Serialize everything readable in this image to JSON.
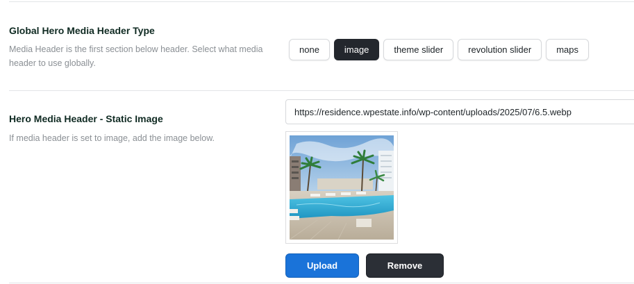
{
  "media_type": {
    "title": "Global Hero Media Header Type",
    "description": "Media Header is the first section below header. Select what media header to use globally.",
    "options": [
      {
        "label": "none",
        "active": false
      },
      {
        "label": "image",
        "active": true
      },
      {
        "label": "theme slider",
        "active": false
      },
      {
        "label": "revolution slider",
        "active": false
      },
      {
        "label": "maps",
        "active": false
      }
    ]
  },
  "static_image": {
    "title": "Hero Media Header - Static Image",
    "description": "If media header is set to image, add the image below.",
    "url": "https://residence.wpestate.info/wp-content/uploads/2025/07/6.5.webp",
    "upload_label": "Upload",
    "remove_label": "Remove"
  },
  "colors": {
    "primary": "#1a73d9",
    "dark": "#2b2f36",
    "active_option": "#23272d"
  }
}
